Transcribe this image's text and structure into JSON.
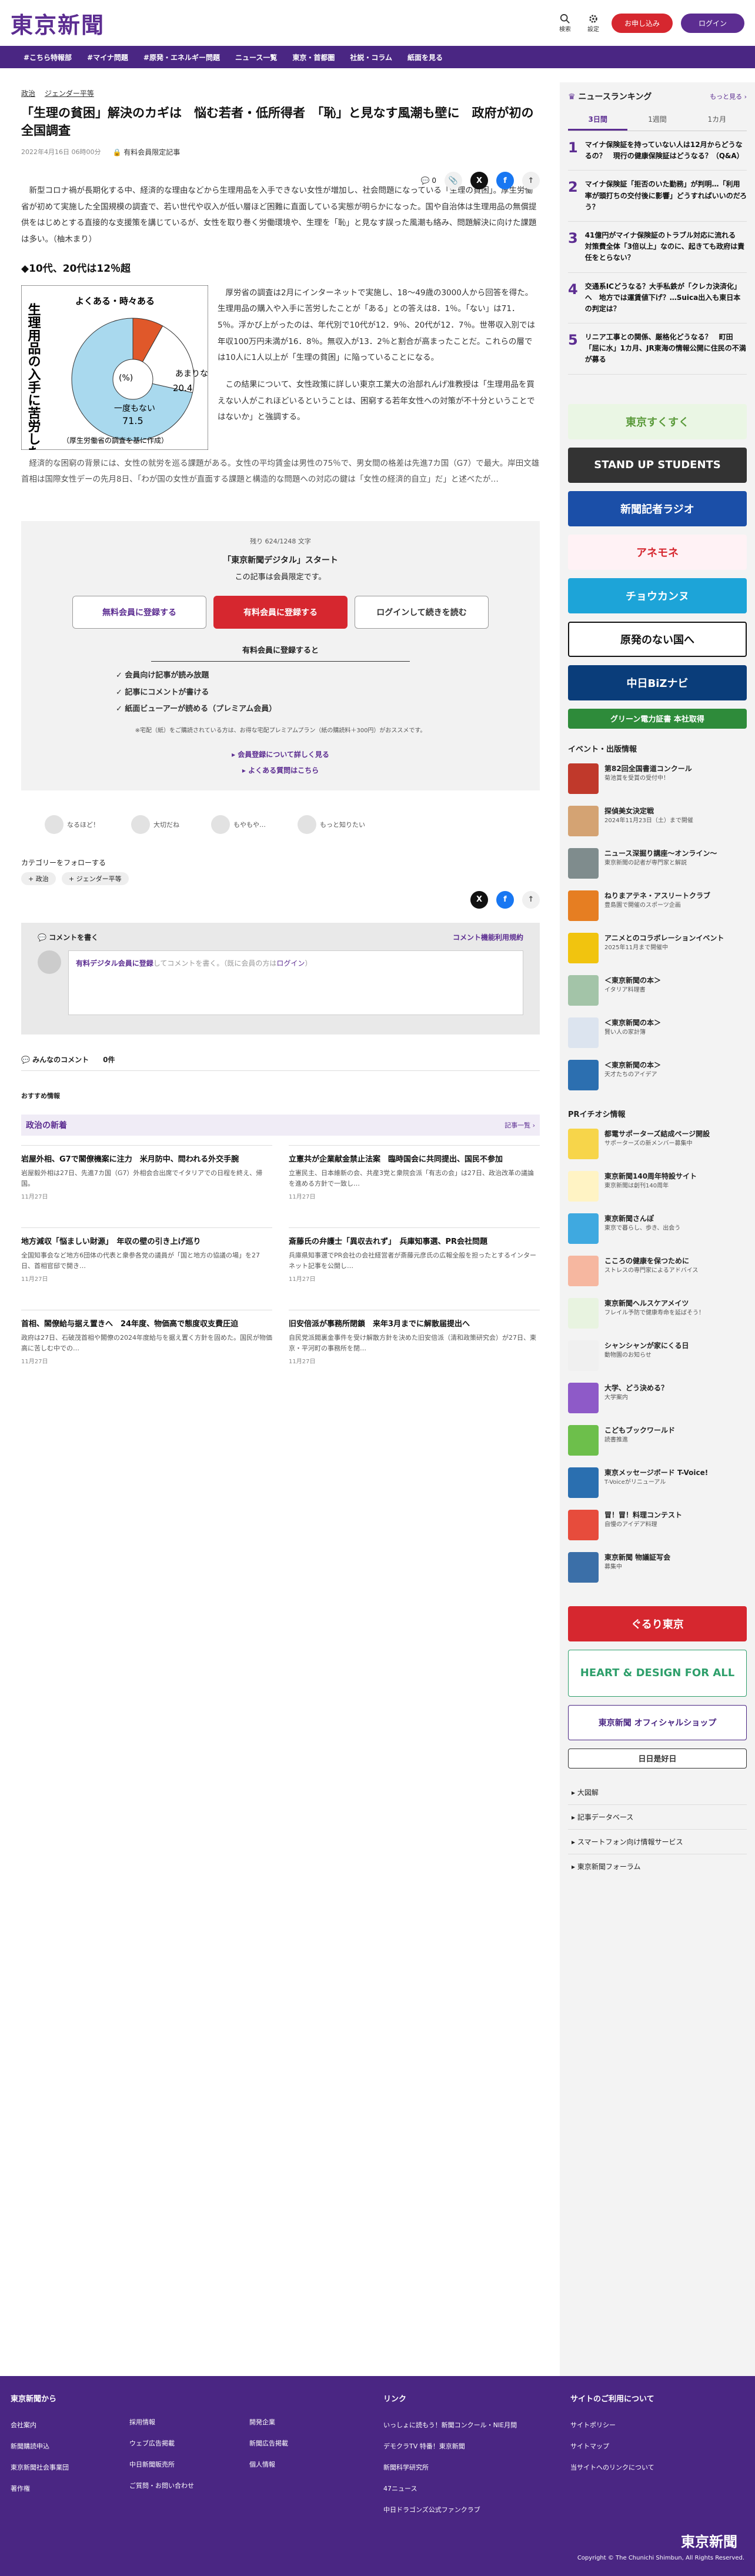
{
  "header": {
    "logo": "東京新聞",
    "search": "検索",
    "settings": "設定",
    "signup": "お申し込み",
    "login": "ログイン"
  },
  "nav": [
    "#こちら特報部",
    "#マイナ問題",
    "#原発・エネルギー問題",
    "ニュース一覧",
    "東京・首都圏",
    "社説・コラム",
    "紙面を見る"
  ],
  "article": {
    "categories": [
      "政治",
      "ジェンダー平等"
    ],
    "title": "「生理の貧困」解決のカギは　悩む若者・低所得者　「恥」と見なす風潮も壁に　政府が初の全国調査",
    "date": "2022年4月16日 06時00分",
    "badge": "有料会員限定記事",
    "comment_count": "0",
    "p1": "新型コロナ禍が長期化する中、経済的な理由などから生理用品を入手できない女性が増加し、社会問題になっている「生理の貧困」。厚生労働省が初めて実施した全国規模の調査で、若い世代や収入が低い層ほど困難に直面している実態が明らかになった。国や自治体は生理用品の無償提供をはじめとする直接的な支援策を講じているが、女性を取り巻く労働環境や、生理を「恥」と見なす誤った風潮も絡み、問題解決に向けた課題は多い。（柚木まり）",
    "h2": "◆10代、20代は12％超",
    "p2": "厚労省の調査は2月にインターネットで実施し、18～49歳の3000人から回答を得た。生理用品の購入や入手に苦労したことが「ある」との答えは8．1％。「ない」は71．5％。浮かび上がったのは、年代別で10代が12．9％、20代が12．7％。世帯収入別では年収100万円未満が16．8％。無収入が13．2％と割合が高まったことだ。これらの層では10人に1人以上が「生理の貧困」に陥っていることになる。",
    "p3": "この結果について、女性政策に詳しい東京工業大の治部れんげ准教授は「生理用品を買えない人がこれほどいるということは、困窮する若年女性への対策が不十分ということではないか」と強調する。",
    "p4": "経済的な困窮の背景には、女性の就労を巡る課題がある。女性の平均賃金は男性の75％で、男女間の格差は先進7カ国（G7）で最大。岸田文雄首相は国際女性デーの先月8日、「わが国の女性が直面する課題と構造的な問題への対応の鍵は「女性の経済的自立」だ」と述べたが…",
    "figure": {
      "vertical": "生理用品の入手に苦労した人の割合",
      "caption": "（厚生労働省の調査を基に作成）",
      "label_yes": "よくある・時々ある",
      "label_mid": "あまりない",
      "label_no": "一度もない",
      "unit": "(%)",
      "v_yes": "8.1",
      "v_mid": "20.4",
      "v_no": "71.5"
    }
  },
  "chart_data": {
    "type": "pie",
    "title": "",
    "categories": [
      "よくある・時々ある",
      "あまりない",
      "一度もない"
    ],
    "values": [
      8.1,
      20.4,
      71.5
    ],
    "colors": [
      "#e0582a",
      "#ffffff",
      "#a9d9ee"
    ]
  },
  "paywall": {
    "chars": "残り 624/1248 文字",
    "line1": "「東京新聞デジタル」スタート",
    "line2": "この記事は会員限定です。",
    "btn_free": "無料会員に登録する",
    "btn_paid": "有料会員に登録する",
    "btn_login": "ログインして続きを読む",
    "subhead": "有料会員に登録すると",
    "checks": [
      "会員向け記事が読み放題",
      "記事にコメントが書ける",
      "紙面ビューアーが読める（プレミアム会員）"
    ],
    "note": "※宅配（紙）をご購読されている方は、お得な宅配プレミアムプラン（紙の購読料＋300円）がおススメです。",
    "link1": "会員登録について詳しく見る",
    "link2": "よくある質問はこちら"
  },
  "reactions": [
    "なるほど！",
    "大切だね",
    "もやもや…",
    "もっと知りたい"
  ],
  "follow": {
    "label": "カテゴリーをフォローする",
    "tags": [
      "政治",
      "ジェンダー平等"
    ]
  },
  "comment": {
    "header": "コメントを書く",
    "rules": "コメント機能利用規約",
    "placeholder_link": "有料デジタル会員に登録",
    "placeholder": "してコメントを書く。（既に会員の方は",
    "login": "ログイン",
    "end": "）",
    "all": "みんなのコメント",
    "count": "0件"
  },
  "reco": "おすすめ情報",
  "section": {
    "title": "政治の新着",
    "more": "記事一覧"
  },
  "cards": [
    {
      "t": "岩屋外相、G7で閣僚機案に注力　米月防中、問われる外交手腕",
      "d": "岩屋毅外相は27日、先進7カ国（G7）外相会合出席でイタリアでの日程を終え、帰国。",
      "dt": "11月27日"
    },
    {
      "t": "立憲共が企業献金禁止法案　臨時国会に共同提出、国民不参加",
      "d": "立憲民主、日本維新の会、共産3党と衆院会派「有志の会」は27日、政治改革の議論を進める方針で一致し…",
      "dt": "11月27日"
    },
    {
      "t": "地方減収「悩ましい財源」　年収の壁の引き上げ巡り",
      "d": "全国知事会など地方6団体の代表と衆参各党の議員が「国と地方の協議の場」を27日、首相官邸で開き…",
      "dt": "11月27日"
    },
    {
      "t": "斎藤氏の弁護士「異収去れず」　兵庫知事選、PR会社問題",
      "d": "兵庫県知事選でPR会社の会社経営者が斎藤元彦氏の広報全般を担ったとするインターネット記事を公開し…",
      "dt": "11月27日"
    },
    {
      "t": "首相、閣僚給与据え置きへ　24年度、物価高で態度収支費圧迫",
      "d": "政府は27日、石破茂首相や閣僚の2024年度給与を据え置く方針を固めた。国民が物価高に苦しむ中での…",
      "dt": "11月27日"
    },
    {
      "t": "旧安倍派が事務所閉鎖　来年3月までに解散届提出へ",
      "d": "自民党派閥裏金事件を受け解散方針を決めた旧安倍派（清和政策研究会）が27日、東京・平河町の事務所を閉…",
      "dt": "11月27日"
    }
  ],
  "side": {
    "ranking": "ニュースランキング",
    "more": "もっと見る",
    "tabs": [
      "3日間",
      "1週間",
      "1カ月"
    ],
    "items": [
      "マイナ保険証を持っていない人は12月からどうなるの？　現行の健康保険証はどうなる？（Q&A）",
      "マイナ保険証「拒否のいた勤務」が判明…「利用率が頭打ちの交付後に影響」どうすればいいのだろう？",
      "41億円がマイナ保険証のトラブル対応に流れる　対策費全体「3倍以上」なのに、起きても政府は責任をとらない？",
      "交通系ICどうなる？大手私鉄が「クレカ決済化」へ　地方では運賃値下げ？…Suica出入も東日本の判定は？",
      "リニア工事との関係、厳格化どうなる？　町田「屈に水」1カ月、JR東海の情報公開に住民の不満が募る"
    ],
    "banners": [
      "東京すくすく",
      "STAND UP STUDENTS",
      "新聞記者ラジオ",
      "アネモネ",
      "チョウカンヌ",
      "原発のない国へ",
      "中日BiZナビ",
      "グリーン電力証書 本社取得"
    ],
    "events_title": "イベント・出版情報",
    "events": [
      {
        "t": "第82回全国書道コンクール",
        "d": "菊池賞を受賞の受付中！"
      },
      {
        "t": "探偵美女決定戦",
        "d": "2024年11月23日（土）まで開催"
      },
      {
        "t": "ニュース深掘り講座〜オンライン〜",
        "d": "東京新聞の記者が専門家と解説"
      },
      {
        "t": "ねりまアテネ・アスリートクラブ",
        "d": "豊島園で開催のスポーツ企画"
      },
      {
        "t": "アニメとのコラボレーションイベント",
        "d": "2025年11月まで開催中"
      },
      {
        "t": "＜東京新聞の本＞",
        "d": "イタリア料理書"
      },
      {
        "t": "＜東京新聞の本＞",
        "d": "賢い人の家計簿"
      },
      {
        "t": "＜東京新聞の本＞",
        "d": "天才たちのアイデア"
      }
    ],
    "pr_title": "PRイチオシ情報",
    "pr": [
      {
        "t": "都電サポーターズ結成ページ開設",
        "d": "サポーターズの新メンバー募集中"
      },
      {
        "t": "東京新聞140周年特設サイト",
        "d": "東京新聞は創刊140周年"
      },
      {
        "t": "東京新聞さんぽ",
        "d": "東京で暮らし、歩き、出会う"
      },
      {
        "t": "こころの健康を保つために",
        "d": "ストレスの専門家によるアドバイス"
      },
      {
        "t": "東京新聞ヘルスケアメイツ",
        "d": "フレイル予防で健康寿命を延ばそう！"
      },
      {
        "t": "シャンシャンが家にくる日",
        "d": "動物園のお知らせ"
      },
      {
        "t": "大学、どう決める？",
        "d": "大学案内"
      },
      {
        "t": "こどもブックワールド",
        "d": "読書推進"
      },
      {
        "t": "東京メッセージボード T-Voice!",
        "d": "T-Voiceがリニューアル"
      },
      {
        "t": "冒！冒！料理コンテスト",
        "d": "自慢のアイデア料理"
      },
      {
        "t": "東京新聞 物議証写会",
        "d": "募集中"
      }
    ],
    "ad_banners": [
      "ぐるり東京",
      "HEART & DESIGN FOR ALL",
      "東京新聞 オフィシャルショップ",
      "日日是好日"
    ],
    "links": [
      "大図解",
      "記事データベース",
      "スマートフォン向け情報サービス",
      "東京新聞フォーラム"
    ]
  },
  "footer": {
    "col1": "東京新聞から",
    "c1": [
      "会社案内",
      "新聞購読申込",
      "東京新聞社会事業団",
      "著作権"
    ],
    "c2": [
      "採用情報",
      "ウェブ広告掲載",
      "中日新聞販売所",
      "ご質問・お問い合わせ"
    ],
    "c3": [
      "開発企業",
      "新聞広告掲載",
      "個人情報"
    ],
    "col2": "リンク",
    "c4": [
      "いっしょに読もう！新聞コンクール・NIE月間",
      "デモクラTV 特番！東京新聞",
      "新聞科学研究所",
      "47ニュース",
      "中日ドラゴンズ公式ファンクラブ"
    ],
    "col3": "サイトのご利用について",
    "c5": [
      "サイトポリシー",
      "サイトマップ",
      "当サイトへのリンクについて"
    ],
    "logo": "東京新聞",
    "copy": "Copyright © The Chunichi Shimbun, All Rights Reserved."
  }
}
